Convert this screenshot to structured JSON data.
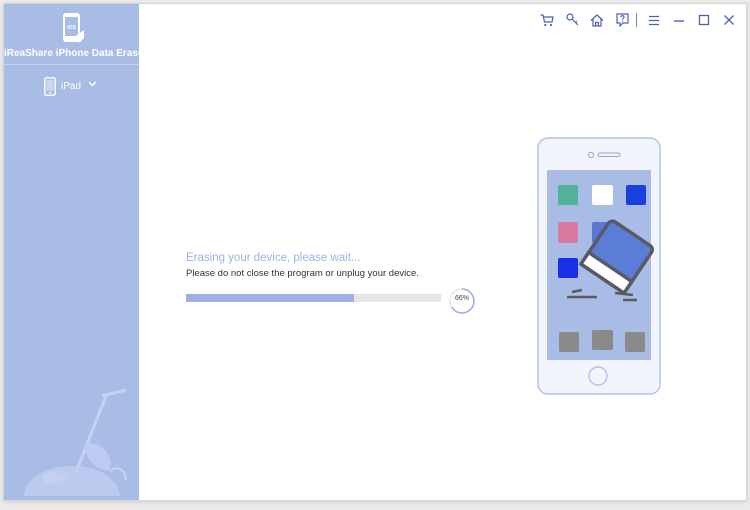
{
  "app": {
    "title": "iReaShare iPhone Data Eraser",
    "logo_icon": "phone-ios-icon",
    "logo_text": "iOS"
  },
  "sidebar": {
    "device": {
      "label": "iPad",
      "icon": "tablet-icon",
      "chevron": "chevron-down-icon"
    },
    "decoration": "vacuum-cleaner-illustration"
  },
  "toolbar": {
    "buttons": [
      {
        "name": "cart-icon"
      },
      {
        "name": "key-icon"
      },
      {
        "name": "home-icon"
      },
      {
        "name": "help-icon"
      },
      {
        "name": "menu-icon"
      },
      {
        "name": "minimize-icon"
      },
      {
        "name": "maximize-icon"
      },
      {
        "name": "close-icon"
      }
    ]
  },
  "status": {
    "title": "Erasing your device, please wait...",
    "subtitle": "Please do not close the program or unplug your device.",
    "progress": 0.66,
    "percent_label": "66%"
  },
  "illustration": {
    "name": "phone-with-eraser",
    "app_colors": [
      "#52b29b",
      "#ffffff",
      "#1840e0",
      "#d97aa1",
      "#5877d6",
      "#1530e6"
    ],
    "dock_color": "#8a8a8a"
  },
  "colors": {
    "sidebar": "#a9bce6",
    "accent": "#9db0e3",
    "toolbar_icons": "#4a5fc0"
  }
}
